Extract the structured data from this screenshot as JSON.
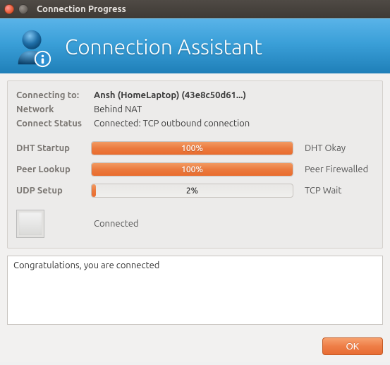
{
  "window": {
    "title": "Connection Progress"
  },
  "header": {
    "title": "Connection Assistant"
  },
  "info": {
    "connecting_to_label": "Connecting to:",
    "connecting_to_value": "Ansh (HomeLaptop) (43e8c50d61...)",
    "network_label": "Network",
    "network_value": "Behind NAT",
    "connect_status_label": "Connect Status",
    "connect_status_value": "Connected: TCP outbound connection"
  },
  "progress": {
    "dht": {
      "label": "DHT Startup",
      "percent": 100,
      "text": "100%",
      "status": "DHT Okay"
    },
    "peer": {
      "label": "Peer Lookup",
      "percent": 100,
      "text": "100%",
      "status": "Peer Firewalled"
    },
    "udp": {
      "label": "UDP Setup",
      "percent": 2,
      "text": "2%",
      "status": "TCP Wait"
    }
  },
  "connected": {
    "label": "Connected"
  },
  "message": "Congratulations, you are connected",
  "buttons": {
    "ok": "OK"
  },
  "colors": {
    "accent": "#eb7a3e",
    "header_blue": "#2e95cf"
  }
}
